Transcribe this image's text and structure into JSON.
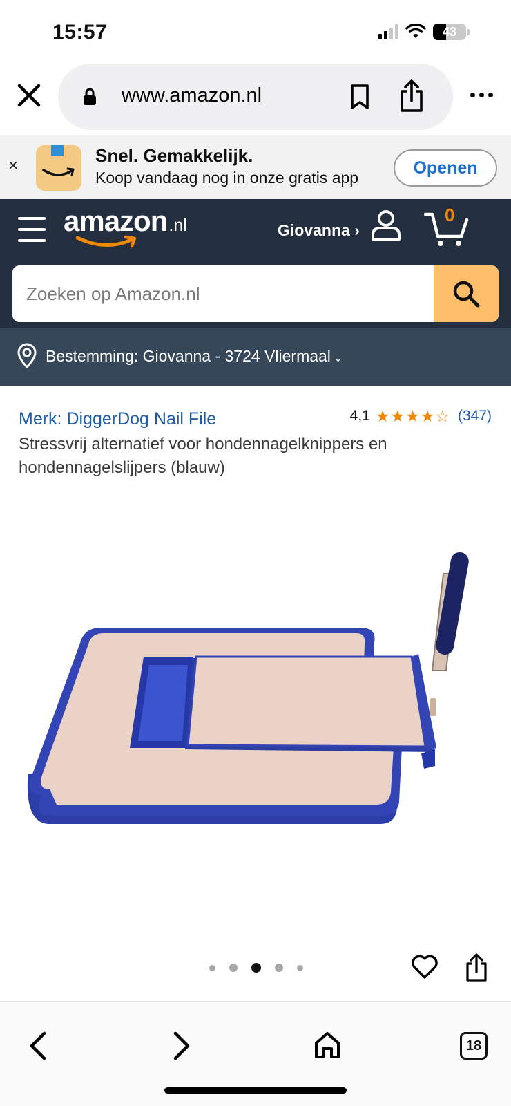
{
  "status_bar": {
    "time": "15:57",
    "battery": "43"
  },
  "browser": {
    "url": "www.amazon.nl"
  },
  "app_banner": {
    "close": "×",
    "title": "Snel. Gemakkelijk.",
    "subtitle": "Koop vandaag nog in onze gratis app",
    "open_label": "Openen"
  },
  "header": {
    "logo_main": "amazon",
    "logo_tld": ".nl",
    "account_name": "Giovanna ›",
    "cart_count": "0"
  },
  "search": {
    "placeholder": "Zoeken op Amazon.nl"
  },
  "delivery": {
    "text": "Bestemming: Giovanna - 3724 Vliermaal",
    "chevron": "⌄"
  },
  "product": {
    "brand": "Merk: DiggerDog Nail File",
    "rating_value": "4,1",
    "rating": 4.1,
    "rating_count": "(347)",
    "title": "Stressvrij alternatief voor hondennagelknippers en hondennagelslijpers (blauw)"
  },
  "carousel": {
    "total_images": 5,
    "active_index": 3
  },
  "toolbar": {
    "tab_count": "18"
  },
  "colors": {
    "header_bg": "#232f3e",
    "delivery_bg": "#37475a",
    "search_button": "#febd69",
    "star": "#f08804",
    "link": "#1d5ca8"
  },
  "icons": [
    "close-icon",
    "lock-icon",
    "bookmark-icon",
    "share-icon",
    "more-icon",
    "hamburger-icon",
    "user-icon",
    "cart-icon",
    "search-icon",
    "location-pin-icon",
    "star-icon",
    "heart-icon",
    "back-icon",
    "forward-icon",
    "home-icon",
    "tabs-icon"
  ]
}
